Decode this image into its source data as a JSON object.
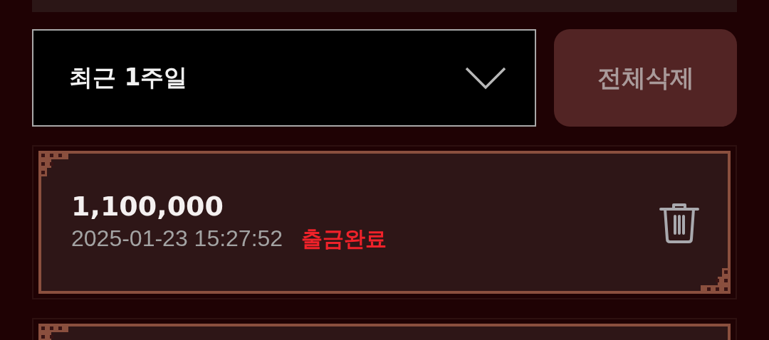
{
  "filter": {
    "value": "최근 1주일"
  },
  "delete_all_button": {
    "label": "전체삭제"
  },
  "records": [
    {
      "amount": "1,100,000",
      "datetime": "2025-01-23 15:27:52",
      "status": "출금완료",
      "color": "#f0222a"
    }
  ]
}
